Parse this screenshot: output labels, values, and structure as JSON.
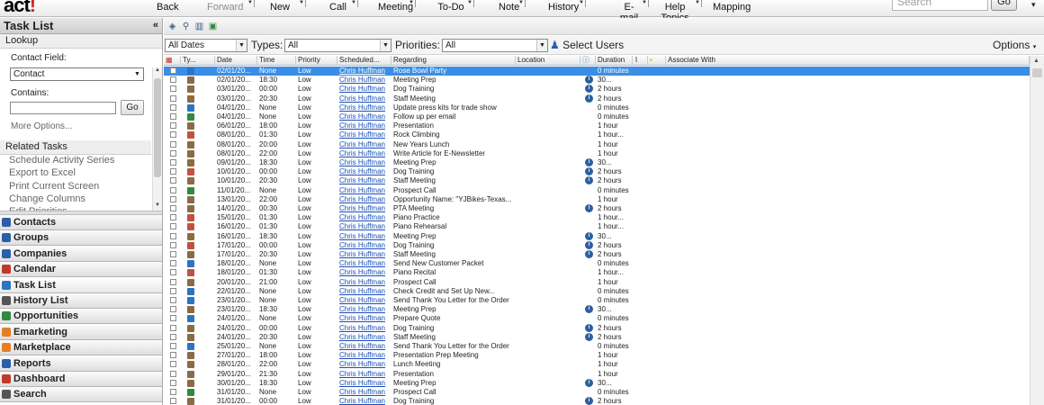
{
  "app": {
    "logo": "act",
    "logo_mark": "!"
  },
  "toolbar": {
    "buttons": [
      {
        "label": "Back",
        "enabled": true
      },
      {
        "label": "Forward",
        "enabled": false
      },
      {
        "label": "New",
        "enabled": true
      },
      {
        "label": "Call",
        "enabled": true
      },
      {
        "label": "Meeting",
        "enabled": true
      },
      {
        "label": "To-Do",
        "enabled": true
      },
      {
        "label": "Note",
        "enabled": true
      },
      {
        "label": "History",
        "enabled": true
      },
      {
        "label": "E-mail",
        "enabled": true
      },
      {
        "label": "Help Topics",
        "enabled": true
      },
      {
        "label": "Mapping",
        "enabled": true
      }
    ],
    "search_placeholder": "Search",
    "go_label": "Go"
  },
  "left_panel": {
    "title": "Task List",
    "collapse_glyph": "«",
    "lookup": {
      "heading": "Lookup",
      "contact_field_label": "Contact Field:",
      "contact_field_value": "Contact",
      "contains_label": "Contains:",
      "contains_value": "",
      "go_label": "Go",
      "more_options": "More Options..."
    },
    "related_tasks": {
      "heading": "Related Tasks",
      "items": [
        "Schedule Activity Series",
        "Export to Excel",
        "Print Current Screen",
        "Change Columns",
        "Edit Priorities"
      ]
    },
    "nav": [
      {
        "label": "Contacts",
        "color": "#2b5ea8",
        "selected": false
      },
      {
        "label": "Groups",
        "color": "#2b5ea8",
        "selected": false
      },
      {
        "label": "Companies",
        "color": "#2b5ea8",
        "selected": false
      },
      {
        "label": "Calendar",
        "color": "#c0392b",
        "selected": false
      },
      {
        "label": "Task List",
        "color": "#2a75c4",
        "selected": true
      },
      {
        "label": "History List",
        "color": "#555555",
        "selected": false
      },
      {
        "label": "Opportunities",
        "color": "#2e8b3f",
        "selected": false
      },
      {
        "label": "Emarketing",
        "color": "#e67e22",
        "selected": false
      },
      {
        "label": "Marketplace",
        "color": "#e67e22",
        "selected": false
      },
      {
        "label": "Reports",
        "color": "#2b5ea8",
        "selected": false
      },
      {
        "label": "Dashboard",
        "color": "#c0392b",
        "selected": false
      },
      {
        "label": "Search",
        "color": "#555555",
        "selected": false
      }
    ]
  },
  "filters": {
    "dates_value": "All Dates",
    "types_label": "Types:",
    "types_value": "All",
    "priorities_label": "Priorities:",
    "priorities_value": "All",
    "select_users": "Select Users",
    "options": "Options"
  },
  "grid": {
    "columns": [
      {
        "key": "check",
        "label": ""
      },
      {
        "key": "type",
        "label": "Ty..."
      },
      {
        "key": "date",
        "label": "Date"
      },
      {
        "key": "time",
        "label": "Time"
      },
      {
        "key": "priority",
        "label": "Priority"
      },
      {
        "key": "scheduled",
        "label": "Scheduled..."
      },
      {
        "key": "regarding",
        "label": "Regarding"
      },
      {
        "key": "location",
        "label": "Location"
      },
      {
        "key": "info",
        "label": ""
      },
      {
        "key": "duration",
        "label": "Duration"
      },
      {
        "key": "attach",
        "label": ""
      },
      {
        "key": "lock",
        "label": ""
      },
      {
        "key": "associate",
        "label": "Associate With"
      }
    ],
    "rows": [
      {
        "type": "todo",
        "date": "02/01/20...",
        "time": "None",
        "priority": "Low",
        "scheduled": "Chris Huffman",
        "regarding": "Rose Bowl Party",
        "info": false,
        "duration": "0 minutes",
        "selected": true
      },
      {
        "type": "call",
        "date": "02/01/20...",
        "time": "18:30",
        "priority": "Low",
        "scheduled": "Chris Huffman",
        "regarding": "Meeting Prep",
        "info": true,
        "duration": "30..."
      },
      {
        "type": "call",
        "date": "03/01/20...",
        "time": "00:00",
        "priority": "Low",
        "scheduled": "Chris Huffman",
        "regarding": "Dog Training",
        "info": true,
        "duration": "2 hours"
      },
      {
        "type": "call",
        "date": "03/01/20...",
        "time": "20:30",
        "priority": "Low",
        "scheduled": "Chris Huffman",
        "regarding": "Staff Meeting",
        "info": true,
        "duration": "2 hours"
      },
      {
        "type": "todo",
        "date": "04/01/20...",
        "time": "None",
        "priority": "Low",
        "scheduled": "Chris Huffman",
        "regarding": "Update press kits for trade show",
        "info": false,
        "duration": "0 minutes"
      },
      {
        "type": "group",
        "date": "04/01/20...",
        "time": "None",
        "priority": "Low",
        "scheduled": "Chris Huffman",
        "regarding": "Follow up per email",
        "info": false,
        "duration": "0 minutes"
      },
      {
        "type": "call",
        "date": "06/01/20...",
        "time": "18:00",
        "priority": "Low",
        "scheduled": "Chris Huffman",
        "regarding": "Presentation",
        "info": false,
        "duration": "1 hour"
      },
      {
        "type": "meet",
        "date": "08/01/20...",
        "time": "01:30",
        "priority": "Low",
        "scheduled": "Chris Huffman",
        "regarding": "Rock Climbing",
        "info": false,
        "duration": "1 hour..."
      },
      {
        "type": "call",
        "date": "08/01/20...",
        "time": "20:00",
        "priority": "Low",
        "scheduled": "Chris Huffman",
        "regarding": "New Years Lunch",
        "info": false,
        "duration": "1 hour"
      },
      {
        "type": "call",
        "date": "08/01/20...",
        "time": "22:00",
        "priority": "Low",
        "scheduled": "Chris Huffman",
        "regarding": "Write Article for E-Newsletter",
        "info": false,
        "duration": "1 hour"
      },
      {
        "type": "call",
        "date": "09/01/20...",
        "time": "18:30",
        "priority": "Low",
        "scheduled": "Chris Huffman",
        "regarding": "Meeting Prep",
        "info": true,
        "duration": "30..."
      },
      {
        "type": "meet",
        "date": "10/01/20...",
        "time": "00:00",
        "priority": "Low",
        "scheduled": "Chris Huffman",
        "regarding": "Dog Training",
        "info": true,
        "duration": "2 hours"
      },
      {
        "type": "call",
        "date": "10/01/20...",
        "time": "20:30",
        "priority": "Low",
        "scheduled": "Chris Huffman",
        "regarding": "Staff Meeting",
        "info": true,
        "duration": "2 hours"
      },
      {
        "type": "group",
        "date": "11/01/20...",
        "time": "None",
        "priority": "Low",
        "scheduled": "Chris Huffman",
        "regarding": "Prospect Call",
        "info": false,
        "duration": "0 minutes"
      },
      {
        "type": "call",
        "date": "13/01/20...",
        "time": "22:00",
        "priority": "Low",
        "scheduled": "Chris Huffman",
        "regarding": "Opportunity  Name:  \"YJBikes-Texas...",
        "info": false,
        "duration": "1 hour"
      },
      {
        "type": "call",
        "date": "14/01/20...",
        "time": "00:30",
        "priority": "Low",
        "scheduled": "Chris Huffman",
        "regarding": "PTA Meeting",
        "info": true,
        "duration": "2 hours"
      },
      {
        "type": "meet",
        "date": "15/01/20...",
        "time": "01:30",
        "priority": "Low",
        "scheduled": "Chris Huffman",
        "regarding": "Piano Practice",
        "info": false,
        "duration": "1 hour..."
      },
      {
        "type": "meet",
        "date": "16/01/20...",
        "time": "01:30",
        "priority": "Low",
        "scheduled": "Chris Huffman",
        "regarding": "Piano Rehearsal",
        "info": false,
        "duration": "1 hour..."
      },
      {
        "type": "call",
        "date": "16/01/20...",
        "time": "18:30",
        "priority": "Low",
        "scheduled": "Chris Huffman",
        "regarding": "Meeting Prep",
        "info": true,
        "duration": "30..."
      },
      {
        "type": "meet",
        "date": "17/01/20...",
        "time": "00:00",
        "priority": "Low",
        "scheduled": "Chris Huffman",
        "regarding": "Dog Training",
        "info": true,
        "duration": "2 hours"
      },
      {
        "type": "call",
        "date": "17/01/20...",
        "time": "20:30",
        "priority": "Low",
        "scheduled": "Chris Huffman",
        "regarding": "Staff Meeting",
        "info": true,
        "duration": "2 hours"
      },
      {
        "type": "todo",
        "date": "18/01/20...",
        "time": "None",
        "priority": "Low",
        "scheduled": "Chris Huffman",
        "regarding": "Send New Customer Packet",
        "info": false,
        "duration": "0 minutes"
      },
      {
        "type": "meet",
        "date": "18/01/20...",
        "time": "01:30",
        "priority": "Low",
        "scheduled": "Chris Huffman",
        "regarding": "Piano Recital",
        "info": false,
        "duration": "1 hour..."
      },
      {
        "type": "call",
        "date": "20/01/20...",
        "time": "21:00",
        "priority": "Low",
        "scheduled": "Chris Huffman",
        "regarding": "Prospect Call",
        "info": false,
        "duration": "1 hour"
      },
      {
        "type": "todo",
        "date": "22/01/20...",
        "time": "None",
        "priority": "Low",
        "scheduled": "Chris Huffman",
        "regarding": "Check  Credit  and  Set  Up  New...",
        "info": false,
        "duration": "0 minutes"
      },
      {
        "type": "todo",
        "date": "23/01/20...",
        "time": "None",
        "priority": "Low",
        "scheduled": "Chris Huffman",
        "regarding": "Send Thank You Letter for the Order",
        "info": false,
        "duration": "0 minutes"
      },
      {
        "type": "call",
        "date": "23/01/20...",
        "time": "18:30",
        "priority": "Low",
        "scheduled": "Chris Huffman",
        "regarding": "Meeting Prep",
        "info": true,
        "duration": "30..."
      },
      {
        "type": "todo",
        "date": "24/01/20...",
        "time": "None",
        "priority": "Low",
        "scheduled": "Chris Huffman",
        "regarding": "Prepare Quote",
        "info": false,
        "duration": "0 minutes"
      },
      {
        "type": "call",
        "date": "24/01/20...",
        "time": "00:00",
        "priority": "Low",
        "scheduled": "Chris Huffman",
        "regarding": "Dog Training",
        "info": true,
        "duration": "2 hours"
      },
      {
        "type": "call",
        "date": "24/01/20...",
        "time": "20:30",
        "priority": "Low",
        "scheduled": "Chris Huffman",
        "regarding": "Staff Meeting",
        "info": true,
        "duration": "2 hours"
      },
      {
        "type": "todo",
        "date": "25/01/20...",
        "time": "None",
        "priority": "Low",
        "scheduled": "Chris Huffman",
        "regarding": "Send Thank You Letter for the Order",
        "info": false,
        "duration": "0 minutes"
      },
      {
        "type": "call",
        "date": "27/01/20...",
        "time": "18:00",
        "priority": "Low",
        "scheduled": "Chris Huffman",
        "regarding": "Presentation Prep Meeting",
        "info": false,
        "duration": "1 hour"
      },
      {
        "type": "call",
        "date": "28/01/20...",
        "time": "22:00",
        "priority": "Low",
        "scheduled": "Chris Huffman",
        "regarding": "Lunch Meeting",
        "info": false,
        "duration": "1 hour"
      },
      {
        "type": "call",
        "date": "29/01/20...",
        "time": "21:30",
        "priority": "Low",
        "scheduled": "Chris Huffman",
        "regarding": "Presentation",
        "info": false,
        "duration": "1 hour"
      },
      {
        "type": "call",
        "date": "30/01/20...",
        "time": "18:30",
        "priority": "Low",
        "scheduled": "Chris Huffman",
        "regarding": "Meeting Prep",
        "info": true,
        "duration": "30..."
      },
      {
        "type": "group",
        "date": "31/01/20...",
        "time": "None",
        "priority": "Low",
        "scheduled": "Chris Huffman",
        "regarding": "Prospect Call",
        "info": false,
        "duration": "0 minutes"
      },
      {
        "type": "call",
        "date": "31/01/20...",
        "time": "00:00",
        "priority": "Low",
        "scheduled": "Chris Huffman",
        "regarding": "Dog Training",
        "info": true,
        "duration": "2 hours"
      }
    ]
  },
  "colors": {
    "selection": "#3a8ee6",
    "link": "#1a4fb8",
    "info": "#2d5f9e"
  }
}
